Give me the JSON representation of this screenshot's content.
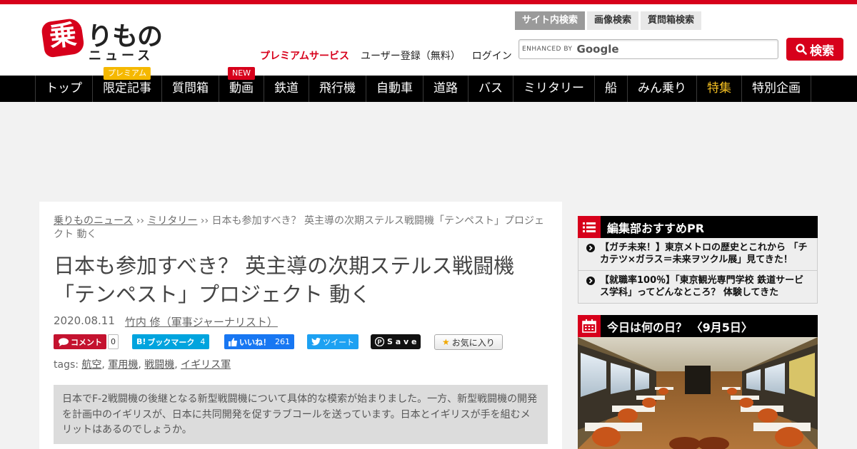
{
  "logo": {
    "mark": "乗",
    "rest": "りもの",
    "sub": "ニュース"
  },
  "header_links": {
    "premium": "プレミアムサービス",
    "register": "ユーザー登録（無料）",
    "login": "ログイン"
  },
  "search_tabs": [
    "サイト内検索",
    "画像検索",
    "質問箱検索"
  ],
  "search": {
    "enhanced_by": "ENHANCED BY",
    "google": "Google",
    "button": "検索"
  },
  "nav": {
    "items": [
      {
        "label": "トップ"
      },
      {
        "label": "限定記事",
        "badge": "プレミアム"
      },
      {
        "label": "質問箱"
      },
      {
        "label": "動画",
        "badge": "NEW"
      },
      {
        "label": "鉄道"
      },
      {
        "label": "飛行機"
      },
      {
        "label": "自動車"
      },
      {
        "label": "道路"
      },
      {
        "label": "バス"
      },
      {
        "label": "ミリタリー"
      },
      {
        "label": "船"
      },
      {
        "label": "みん乗り"
      },
      {
        "label": "特集"
      },
      {
        "label": "特別企画"
      }
    ]
  },
  "breadcrumb": {
    "home": "乗りものニュース",
    "sep": " ›› ",
    "category": "ミリタリー",
    "current": "日本も参加すべき？ 英主導の次期ステルス戦闘機「テンペスト」プロジェクト 動く"
  },
  "article": {
    "title": "日本も参加すべき？ 英主導の次期ステルス戦闘機「テンペスト」プロジェクト 動く",
    "date": "2020.08.11",
    "author": "竹内 修（軍事ジャーナリスト）",
    "summary": "日本でF-2戦闘機の後継となる新型戦闘機について具体的な模索が始まりました。一方、新型戦闘機の開発を計画中のイギリスが、日本に共同開発を促すラブコールを送っています。日本とイギリスが手を組むメリットはあるのでしょうか。"
  },
  "share": {
    "comment": "コメント",
    "comment_count": "0",
    "bookmark": "ブックマーク",
    "bookmark_count": "4",
    "like": "いいね！",
    "like_count": "261",
    "tweet": "ツイート",
    "save": "S a v e",
    "favorite": "お気に入り"
  },
  "tags": {
    "label": "tags:",
    "items": [
      "航空",
      "軍用機",
      "戦闘機",
      "イギリス軍"
    ]
  },
  "sidebar": {
    "pr_title": "編集部おすすめPR",
    "pr_items": [
      "【ガチ未来！】東京メトロの歴史とこれから 「チカテツ×ガラス＝未来ヲツクル展」見てきた！",
      "【就職率100％】「東京観光専門学校 鉄道サービス学科」ってどんなところ？ 体験してきた"
    ],
    "today_title": "今日は何の日？ 〈9月5日〉"
  },
  "colors": {
    "brand_red": "#d7001b",
    "nav_bg": "#000000",
    "special_yellow": "#f5c022"
  }
}
